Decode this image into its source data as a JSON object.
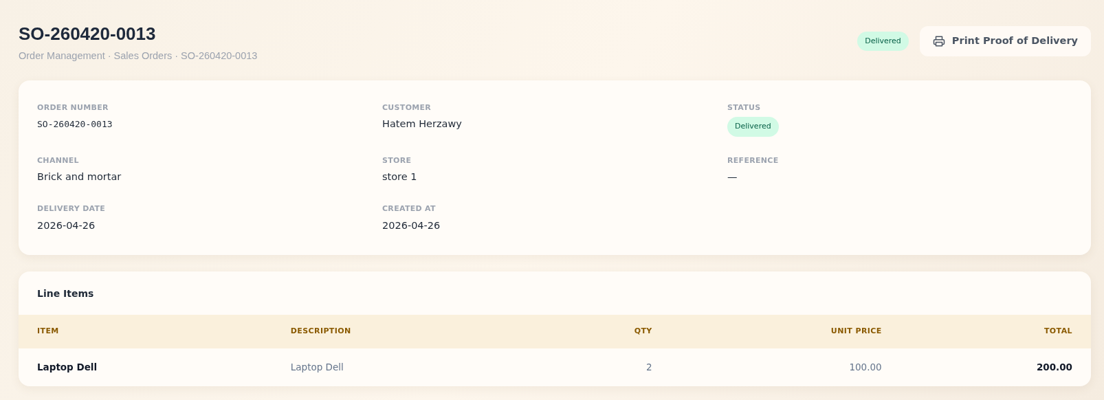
{
  "header": {
    "title": "SO-260420-0013",
    "breadcrumb": "Order Management · Sales Orders · SO-260420-0013",
    "status_badge": "Delivered",
    "print_button": "Print Proof of Delivery"
  },
  "details": [
    {
      "label": "ORDER NUMBER",
      "value": "SO-260420-0013",
      "kind": "mono"
    },
    {
      "label": "CUSTOMER",
      "value": "Hatem Herzawy",
      "kind": "text"
    },
    {
      "label": "STATUS",
      "value": "Delivered",
      "kind": "badge"
    },
    {
      "label": "CHANNEL",
      "value": "Brick and mortar",
      "kind": "text"
    },
    {
      "label": "STORE",
      "value": "store 1",
      "kind": "text"
    },
    {
      "label": "REFERENCE",
      "value": "—",
      "kind": "text"
    },
    {
      "label": "DELIVERY DATE",
      "value": "2026-04-26",
      "kind": "text"
    },
    {
      "label": "CREATED AT",
      "value": "2026-04-26",
      "kind": "text"
    }
  ],
  "line_items": {
    "title": "Line Items",
    "columns": [
      "ITEM",
      "DESCRIPTION",
      "QTY",
      "UNIT PRICE",
      "TOTAL"
    ],
    "rows": [
      [
        "Laptop Dell",
        "Laptop Dell",
        "2",
        "100.00",
        "200.00"
      ]
    ]
  }
}
